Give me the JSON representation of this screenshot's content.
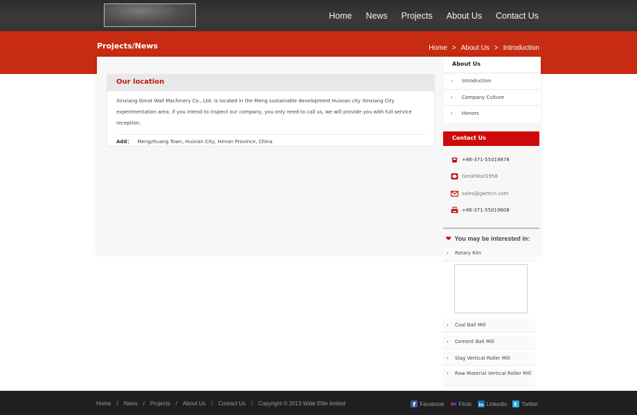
{
  "header": {
    "nav": [
      "Home",
      "News",
      "Projects",
      "About Us",
      "Contact Us"
    ]
  },
  "banner": {
    "section_title": "Projects/News",
    "breadcrumb": [
      "Home",
      "About Us",
      "Introduction"
    ],
    "separator": ">"
  },
  "content": {
    "heading": "Our location",
    "body": "Xinxiang Great Wall Machinery Co., Ltd. is located in the Meng sustainable development Huixian city Xinxiang City experimentation area; if you intend to inspect our company, you only need to call us, we will provide you with full service reception.",
    "address_label": "Add：",
    "address": "Mengzhuang Town, Huixian City, Henan Province, China"
  },
  "sidebar": {
    "about_heading": "About Us",
    "about_items": [
      "Introduction",
      "Company Culture",
      "Honors"
    ],
    "contact_heading": "Contact Us",
    "contacts": [
      {
        "icon": "phone-icon",
        "text": "+86-371-55019878"
      },
      {
        "icon": "chat-icon",
        "text": "GreatWall1958"
      },
      {
        "icon": "mail-icon",
        "text": "sales@gwmcn.com"
      },
      {
        "icon": "fax-icon",
        "text": "+86-371-55019608"
      }
    ],
    "interest_heading": "You may be interested in:",
    "interest_items": [
      "Rotary Kiln",
      "Coal Ball Mill",
      "Cement Ball Mill",
      "Slag Vertical Roller Mill",
      "Raw Material Vertical Roller Mill"
    ]
  },
  "footer": {
    "nav": [
      "Home",
      "News",
      "Projects",
      "About Us",
      "Contact Us"
    ],
    "separator": "/",
    "copyright": "Copyright © 2013 Wide Elite limited",
    "social": [
      {
        "icon": "facebook-icon",
        "label": "Facebook",
        "color": "#3b5998"
      },
      {
        "icon": "flickr-icon",
        "label": "Flickr",
        "color": "#222222"
      },
      {
        "icon": "linkedin-icon",
        "label": "Linkedin",
        "color": "#0e76a8"
      },
      {
        "icon": "twitter-icon",
        "label": "Twitter",
        "color": "#2aa9e0"
      }
    ]
  },
  "colors": {
    "accent_red": "#c72b11",
    "contact_red": "#cf0a0a",
    "header_dark": "#333333",
    "footer_dark": "#1f1f1f"
  }
}
